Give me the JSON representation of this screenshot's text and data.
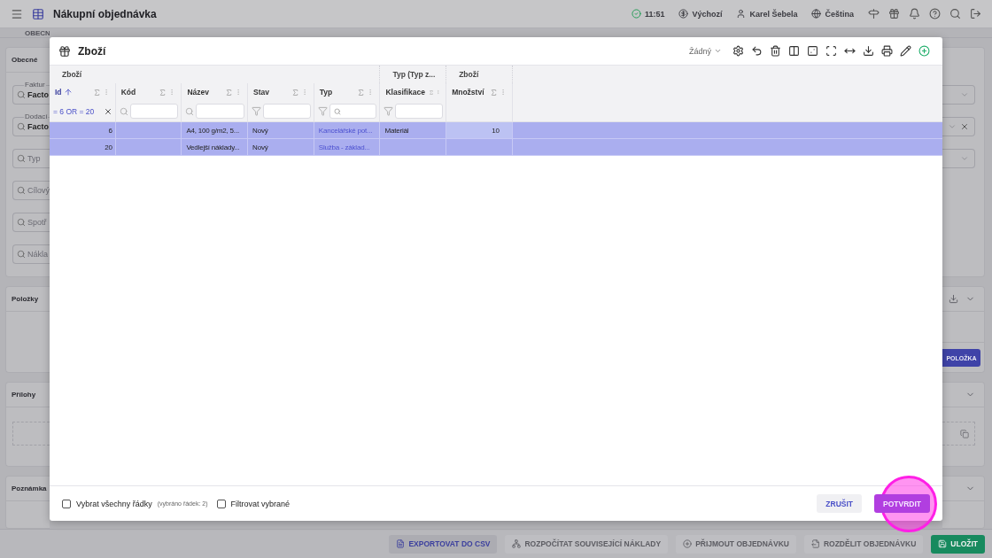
{
  "top_bar": {
    "title": "Nákupní objednávka",
    "status": [
      {
        "kind": "check",
        "text": "11:51"
      },
      {
        "kind": "currency",
        "text": "Výchozí"
      },
      {
        "kind": "user",
        "text": "Karel Šebela"
      },
      {
        "kind": "language",
        "text": "Čeština"
      }
    ]
  },
  "background": {
    "tab": "OBECN",
    "panels": [
      {
        "title": "Obecné",
        "fields": [
          {
            "label": "Faktur",
            "value": "Facto"
          },
          {
            "label": "Dodací",
            "value": "Facto"
          },
          {
            "placeholder": "Typ"
          },
          {
            "placeholder": "Cílový"
          },
          {
            "placeholder": "Spotř"
          },
          {
            "placeholder": "Nákla"
          }
        ]
      },
      {
        "title": "Položky"
      },
      {
        "title": "Přílohy"
      },
      {
        "title": "Poznámka"
      }
    ],
    "add_item_button": "POLOŽKA"
  },
  "actions": [
    {
      "kind": "export",
      "label": "EXPORTOVAT DO CSV",
      "disabled": false
    },
    {
      "kind": "split",
      "label": "ROZPOČÍTAT SOUVISEJÍCÍ NÁKLADY",
      "disabled": true
    },
    {
      "kind": "receive",
      "label": "PŘIJMOUT OBJEDNÁVKU",
      "disabled": true
    },
    {
      "kind": "divide",
      "label": "ROZDĚLIT OBJEDNÁVKU",
      "disabled": true
    },
    {
      "kind": "save",
      "label": "ULOŽIT",
      "disabled": false
    }
  ],
  "dialog": {
    "title": "Zboží",
    "view_select": "Žádný",
    "column_groups": [
      {
        "label": "Zboží",
        "columns": [
          {
            "label": "Id",
            "sorted": true,
            "filter": {
              "kind": "value",
              "text": "= 6 OR = 20"
            }
          },
          {
            "label": "Kód",
            "sorted": false,
            "filter": {
              "kind": "search"
            }
          },
          {
            "label": "Název",
            "sorted": false,
            "filter": {
              "kind": "search"
            }
          },
          {
            "label": "Stav",
            "sorted": false,
            "filter": {
              "kind": "funnel"
            }
          },
          {
            "label": "Typ",
            "sorted": false,
            "filter": {
              "kind": "funnel-search"
            }
          }
        ]
      },
      {
        "label": "Typ (Typ z...",
        "columns": [
          {
            "label": "Klasifikace",
            "sorted": false,
            "filter": {
              "kind": "funnel"
            }
          }
        ]
      },
      {
        "label": "Zboží",
        "columns": [
          {
            "label": "Množství",
            "sorted": false,
            "filter": {
              "kind": "none"
            }
          }
        ]
      }
    ],
    "rows": [
      {
        "selected": true,
        "focused_quantity": true,
        "id": "6",
        "name": "A4, 100 g/m2, 5...",
        "state": "Nový",
        "type": "Kancelářské pot...",
        "classification": "Materiál",
        "quantity": "10"
      },
      {
        "selected": true,
        "focused_quantity": false,
        "id": "20",
        "name": "Vedlejší náklady...",
        "state": "Nový",
        "type": "Služba - základ..."
      }
    ],
    "footer": {
      "select_all": {
        "label": "Vybrat všechny řádky",
        "note": "(vybráno řádek: 2)",
        "checked": false
      },
      "filter_selected": {
        "label": "Filtrovat vybrané",
        "checked": false
      },
      "buttons": [
        {
          "kind": "secondary",
          "label": "ZRUŠIT"
        },
        {
          "kind": "primary",
          "label": "POTVRDIT"
        }
      ]
    }
  }
}
